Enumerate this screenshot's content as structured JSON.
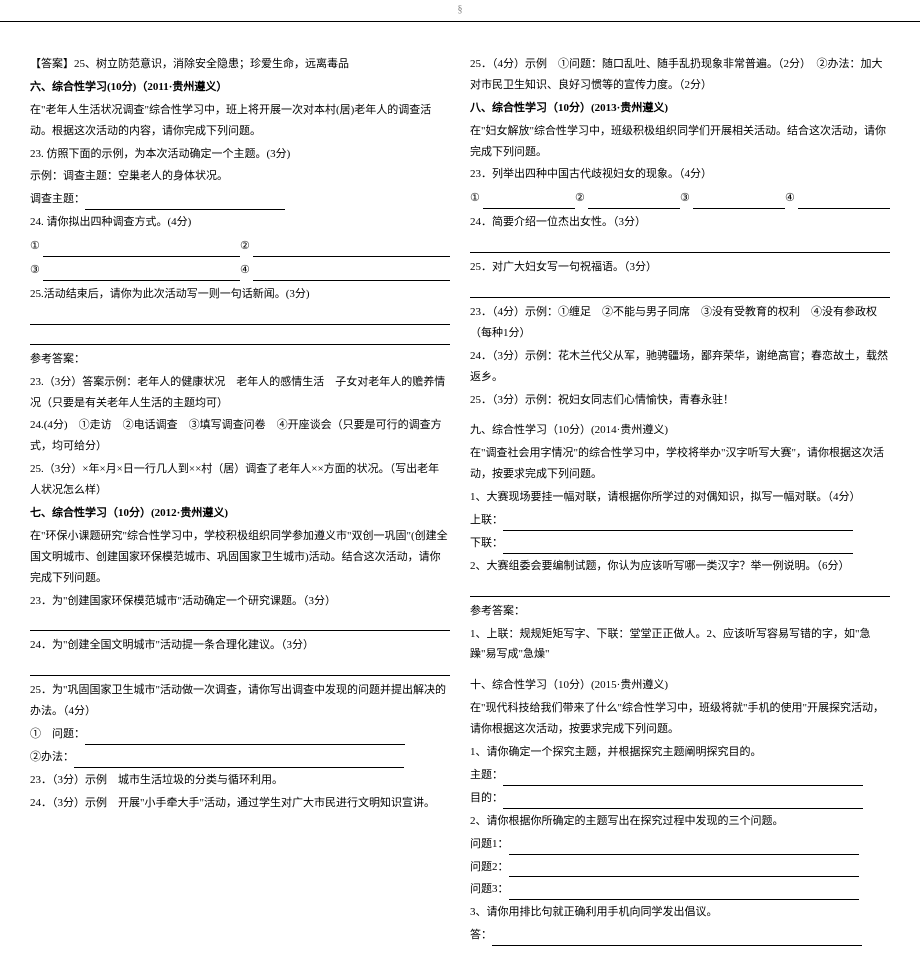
{
  "header_mark": "§",
  "left": {
    "ans25": "【答案】25、树立防范意识，消除安全隐患；珍爱生命，远离毒品",
    "sec6_title": "六、综合性学习(10分)（2011·贵州遵义）",
    "sec6_intro": "在\"老年人生活状况调查\"综合性学习中，班上将开展一次对本村(居)老年人的调查活动。根据这次活动的内容，请你完成下列问题。",
    "sec6_q23a": "23. 仿照下面的示例，为本次活动确定一个主题。(3分)",
    "sec6_q23b": "示例：调查主题：空巢老人的身体状况。",
    "sec6_q23c": "调查主题：",
    "sec6_q24": "24. 请你拟出四种调查方式。(4分)",
    "circ1": "①",
    "circ2": "②",
    "circ3": "③",
    "circ4": "④",
    "sec6_q25": "25.活动结束后，请你为此次活动写一则一句话新闻。(3分)",
    "ref_title": "参考答案：",
    "ref_23": "23.（3分）答案示例：老年人的健康状况　老年人的感情生活　子女对老年人的赡养情况（只要是有关老年人生活的主题均可）",
    "ref_24": "24.(4分)　①走访　②电话调查　③填写调查问卷　④开座谈会（只要是可行的调查方式，均可给分）",
    "ref_25": "25.（3分）×年×月×日一行几人到××村（居）调查了老年人××方面的状况。（写出老年人状况怎么样）",
    "sec7_title": "七、综合性学习（10分）(2012·贵州遵义)",
    "sec7_intro": "在\"环保小课题研究\"综合性学习中，学校积极组织同学参加遵义市\"双创一巩固\"(创建全国文明城市、创建国家环保模范城市、巩固国家卫生城市)活动。结合这次活动，请你完成下列问题。",
    "sec7_q23": "23．为\"创建国家环保模范城市\"活动确定一个研究课题。（3分）",
    "sec7_q24": "24．为\"创建全国文明城市\"活动提一条合理化建议。（3分）",
    "sec7_q25": "25．为\"巩固国家卫生城市\"活动做一次调查，请你写出调查中发现的问题并提出解决的办法。（4分）",
    "sec7_q25_1": "①　问题：",
    "sec7_q25_2": "②办法：",
    "sec7_a23": "23．（3分）示例　城市生活垃圾的分类与循环利用。",
    "sec7_a24": "24．（3分）示例　开展\"小手牵大手\"活动，通过学生对广大市民进行文明知识宣讲。"
  },
  "right": {
    "sec7_a25": "25．（4分）示例　①问题：随口乱吐、随手乱扔现象非常普遍。（2分）　②办法：加大对市民卫生知识、良好习惯等的宣传力度。（2分）",
    "sec8_title": "八、综合性学习（10分）(2013·贵州遵义)",
    "sec8_intro": "在\"妇女解放\"综合性学习中，班级积极组织同学们开展相关活动。结合这次活动，请你完成下列问题。",
    "sec8_q23": "23．列举出四种中国古代歧视妇女的现象。（4分）",
    "sec8_q24": "24．简要介绍一位杰出女性。（3分）",
    "sec8_q25": "25．对广大妇女写一句祝福语。（3分）",
    "sec8_a23": "23．（4分）示例：①缠足　②不能与男子同席　③没有受教育的权利　④没有参政权（每种1分）",
    "sec8_a24": "24．（3分）示例：花木兰代父从军，驰骋疆场，鄙弃荣华，谢绝高官；春恋故土，载然返乡。",
    "sec8_a25": "25．（3分）示例：祝妇女同志们心情愉快，青春永驻！",
    "sec9_title": "九、综合性学习（10分）(2014·贵州遵义)",
    "sec9_intro": "在\"调查社会用字情况\"的综合性学习中，学校将举办\"汉字听写大赛\"，请你根据这次活动，按要求完成下列问题。",
    "sec9_q1": "1、大赛现场要挂一幅对联，请根据你所学过的对偶知识，拟写一幅对联。（4分）",
    "sec9_up": "上联：",
    "sec9_dn": "下联：",
    "sec9_q2": "2、大赛组委会要编制试题，你认为应该听写哪一类汉字？举一例说明。（6分）",
    "sec9_ref": "参考答案：",
    "sec9_a1": "1、上联：规规矩矩写字、下联：堂堂正正做人。2、应该听写容易写错的字，如\"急躁\"易写成\"急燥\"",
    "sec10_title": "十、综合性学习（10分）(2015·贵州遵义)",
    "sec10_intro": "在\"现代科技给我们带来了什么\"综合性学习中，班级将就\"手机的使用\"开展探究活动，请你根据这次活动，按要求完成下列问题。",
    "sec10_q1": "1、请你确定一个探究主题，并根据探究主题阐明探究目的。",
    "sec10_zhuti": "主题：",
    "sec10_mudi": "目的：",
    "sec10_q2": "2、请你根据你所确定的主题写出在探究过程中发现的三个问题。",
    "sec10_w1": "问题1：",
    "sec10_w2": "问题2：",
    "sec10_w3": "问题3：",
    "sec10_q3": "3、请你用排比句就正确利用手机向同学发出倡议。",
    "sec10_ans": "答："
  }
}
